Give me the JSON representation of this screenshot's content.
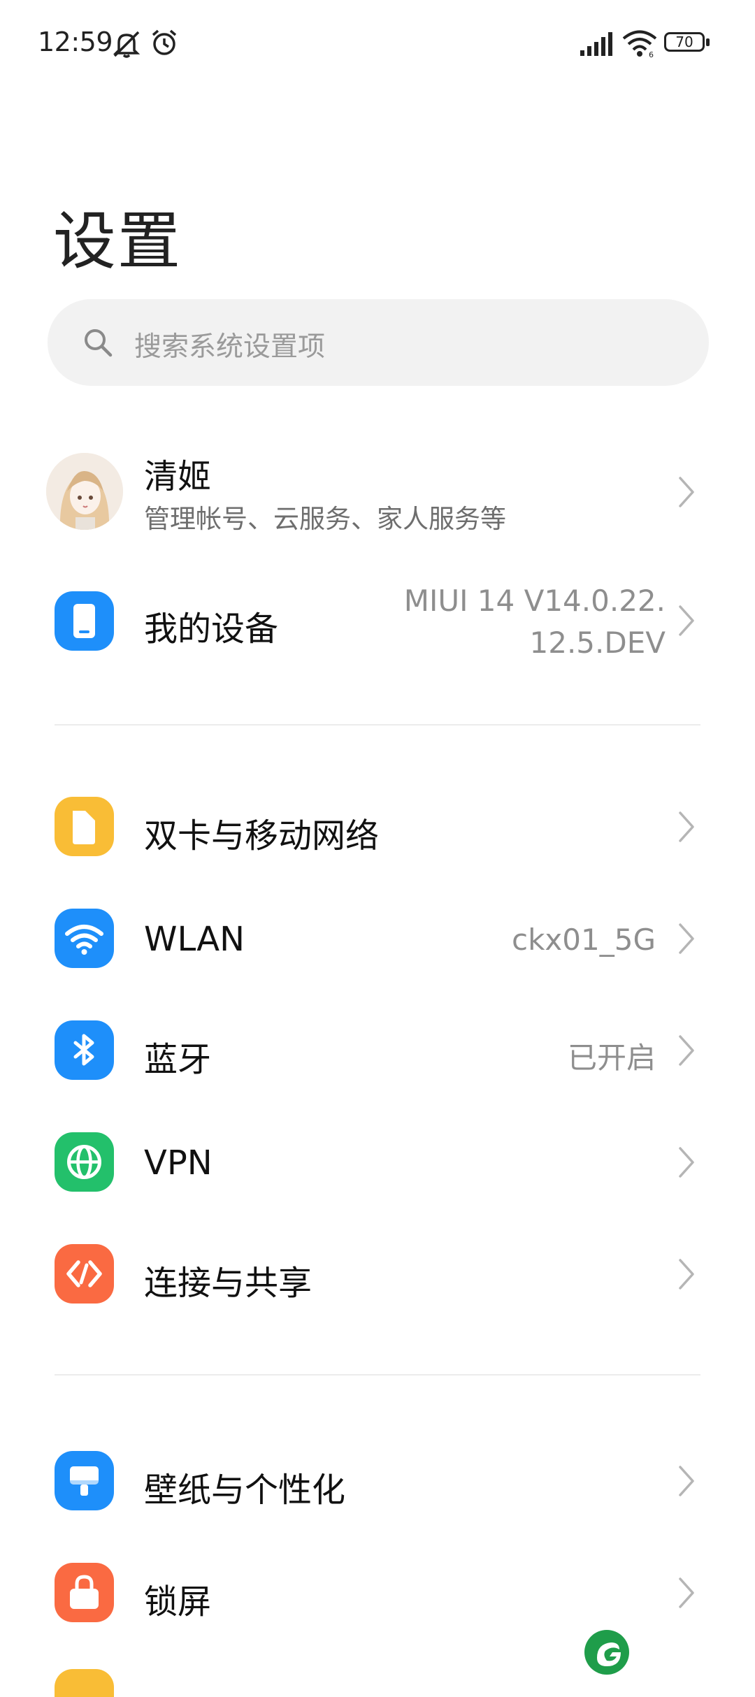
{
  "status_bar": {
    "time": "12:59",
    "battery": "70",
    "icons": [
      "mute-icon",
      "alarm-icon",
      "signal-icon",
      "wifi-icon",
      "battery-icon"
    ]
  },
  "page": {
    "title": "设置"
  },
  "search": {
    "placeholder": "搜索系统设置项"
  },
  "account": {
    "name": "清姬",
    "subtitle": "管理帐号、云服务、家人服务等"
  },
  "device": {
    "label": "我的设备",
    "version_line1": "MIUI 14 V14.0.22.",
    "version_line2": "12.5.DEV"
  },
  "network_section": [
    {
      "label": "双卡与移动网络",
      "value": "",
      "icon": "sim-icon",
      "color": "#f9bd36"
    },
    {
      "label": "WLAN",
      "value": "ckx01_5G",
      "icon": "wifi-icon",
      "color": "#1e8ffa"
    },
    {
      "label": "蓝牙",
      "value": "已开启",
      "icon": "bluetooth-icon",
      "color": "#1e8ffa"
    },
    {
      "label": "VPN",
      "value": "",
      "icon": "globe-icon",
      "color": "#23c06b"
    },
    {
      "label": "连接与共享",
      "value": "",
      "icon": "share-icon",
      "color": "#fa6a42"
    }
  ],
  "personal_section": [
    {
      "label": "壁纸与个性化",
      "value": "",
      "icon": "wallpaper-icon",
      "color": "#1e8ffa"
    },
    {
      "label": "锁屏",
      "value": "",
      "icon": "lock-icon",
      "color": "#fa6a42"
    }
  ],
  "colors": {
    "accent_blue": "#1e8ffa",
    "accent_orange": "#fa6a42",
    "accent_green": "#23c06b",
    "accent_yellow": "#f9bd36"
  }
}
